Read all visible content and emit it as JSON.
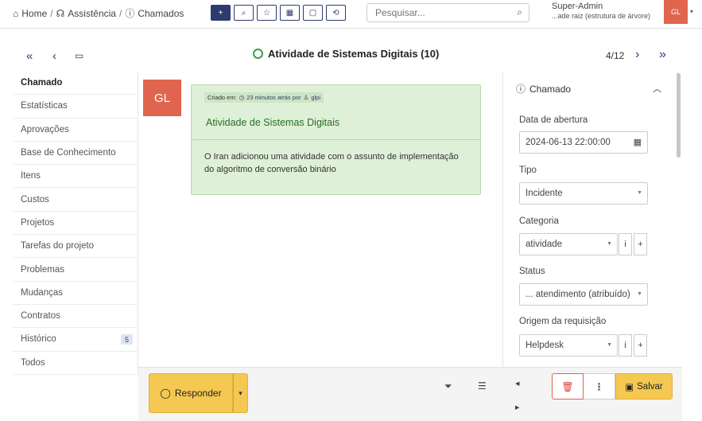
{
  "breadcrumb": {
    "home": "Home",
    "assistance": "Assistência",
    "tickets": "Chamados",
    "separator": "/"
  },
  "toolbar": {
    "add": "+",
    "search": "⌕",
    "star": "☆",
    "grid": "▦",
    "book": "▢",
    "reset": "⟲"
  },
  "search": {
    "placeholder": "Pesquisar..."
  },
  "user": {
    "name": "Super-Admin",
    "entity": "...ade raiz (estrutura de árvore)",
    "initials": "GL"
  },
  "header": {
    "title": "Atividade de Sistemas Digitais (10)",
    "pager": "4/12"
  },
  "nav": {
    "items": [
      {
        "label": "Chamado"
      },
      {
        "label": "Estatísticas"
      },
      {
        "label": "Aprovações"
      },
      {
        "label": "Base de Conhecimento"
      },
      {
        "label": "Itens"
      },
      {
        "label": "Custos"
      },
      {
        "label": "Projetos"
      },
      {
        "label": "Tarefas do projeto"
      },
      {
        "label": "Problemas"
      },
      {
        "label": "Mudanças"
      },
      {
        "label": "Contratos"
      },
      {
        "label": "Histórico",
        "badge": "5"
      },
      {
        "label": "Todos"
      }
    ]
  },
  "timeline": {
    "avatar": "GL",
    "created_label": "Criado em:",
    "created_when": "23 minutos atrás por",
    "created_by": "glpi",
    "title": "Atividade de Sistemas Digitais",
    "body": "O Iran adicionou uma atividade com o assunto de implementação do algoritmo de conversão binário"
  },
  "actions": {
    "reply": "Responder"
  },
  "panel": {
    "title": "Chamado",
    "opening_label": "Data de abertura",
    "opening_value": "2024-06-13 22:00:00",
    "type_label": "Tipo",
    "type_value": "Incidente",
    "category_label": "Categoria",
    "category_value": "atividade",
    "status_label": "Status",
    "status_value": "... atendimento (atribuído)",
    "origin_label": "Origem da requisição",
    "origin_value": "Helpdesk",
    "save": "Salvar"
  },
  "colors": {
    "primary": "#2f3a6e",
    "accent_yellow": "#f4c851",
    "avatar_red": "#e0654f",
    "bubble_green": "#dff0d8",
    "status_green": "#3a9e49"
  }
}
